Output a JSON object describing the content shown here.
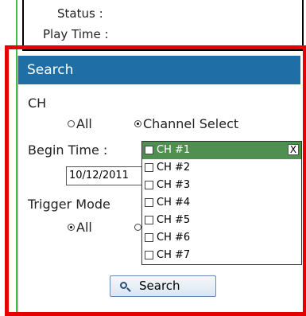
{
  "info": {
    "status_label": "Status :",
    "play_time_label": "Play Time :"
  },
  "panel": {
    "title": "Search",
    "ch_label": "CH",
    "ch_options": {
      "all": "All",
      "channel_select": "Channel Select",
      "selected": "channel_select"
    },
    "begin_time_label": "Begin Time :",
    "begin_date": "10/12/2011",
    "trigger_mode_label": "Trigger Mode",
    "trigger_options": {
      "all": "All",
      "selected": "all"
    },
    "search_button": "Search",
    "icons": [
      "search-icon"
    ]
  },
  "channel_dropdown": {
    "close_label": "X",
    "items": [
      {
        "label": "CH #1",
        "checked": false,
        "highlighted": true
      },
      {
        "label": "CH #2",
        "checked": false,
        "highlighted": false
      },
      {
        "label": "CH #3",
        "checked": false,
        "highlighted": false
      },
      {
        "label": "CH #4",
        "checked": false,
        "highlighted": false
      },
      {
        "label": "CH #5",
        "checked": false,
        "highlighted": false
      },
      {
        "label": "CH #6",
        "checked": false,
        "highlighted": false
      },
      {
        "label": "CH #7",
        "checked": false,
        "highlighted": false
      }
    ]
  },
  "colors": {
    "header": "#1f6fa6",
    "highlight_frame": "#e60000",
    "selected_item": "#4f8f4f",
    "left_line": "#3fbf3f"
  }
}
